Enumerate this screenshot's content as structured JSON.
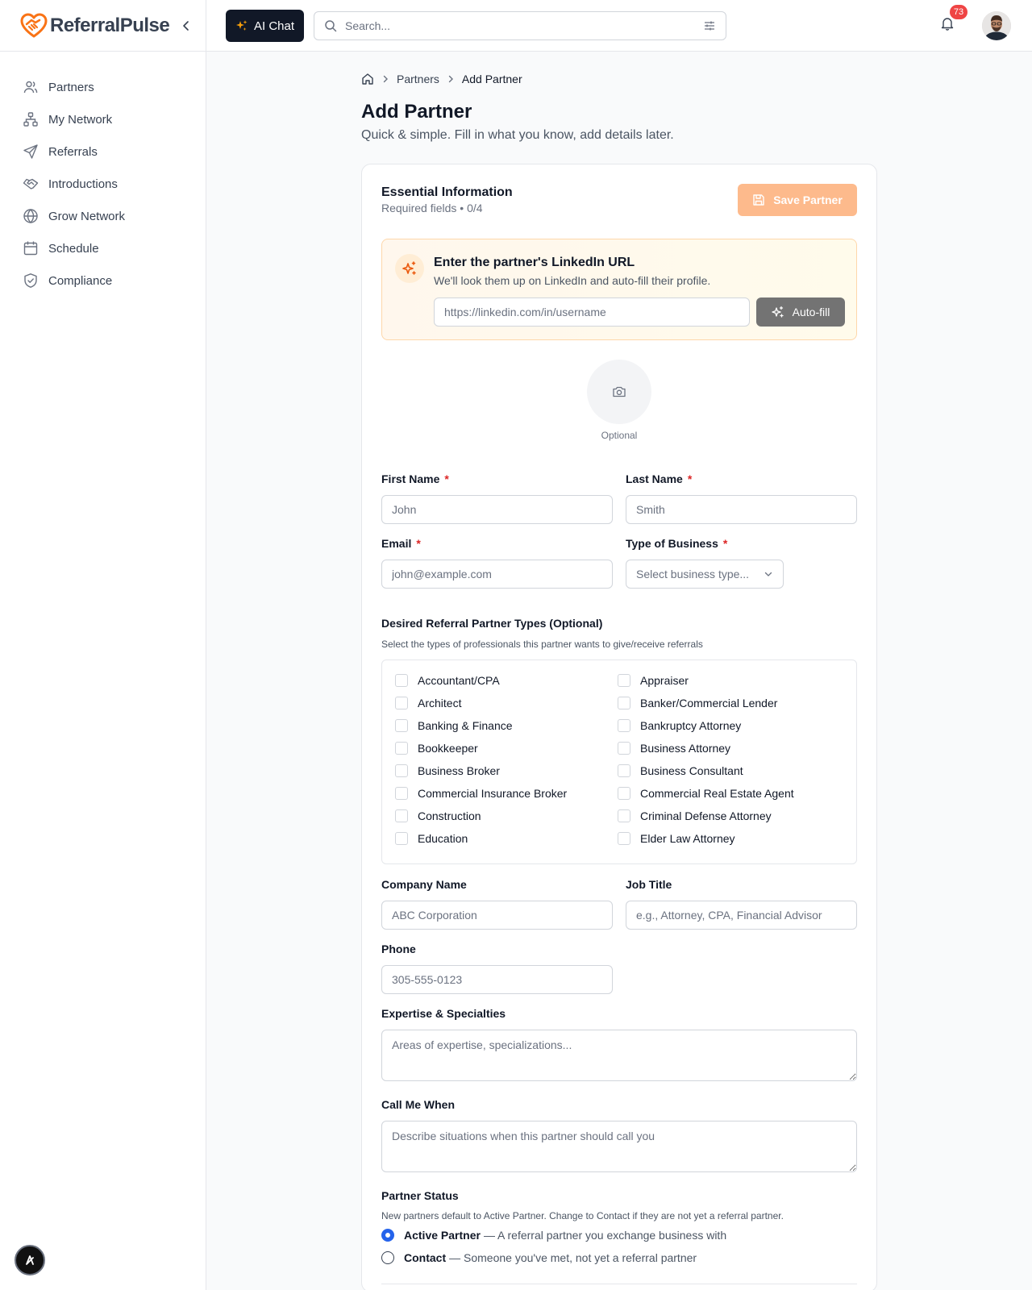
{
  "brand": {
    "name": "ReferralPulse",
    "logo": "heart-handshake-logo",
    "accent": "#f97316"
  },
  "sidebar": {
    "items": [
      {
        "label": "Partners",
        "icon": "users-icon"
      },
      {
        "label": "My Network",
        "icon": "network-icon"
      },
      {
        "label": "Referrals",
        "icon": "send-icon"
      },
      {
        "label": "Introductions",
        "icon": "handshake-icon"
      },
      {
        "label": "Grow Network",
        "icon": "globe-icon"
      },
      {
        "label": "Schedule",
        "icon": "calendar-icon"
      },
      {
        "label": "Compliance",
        "icon": "shield-check-icon"
      }
    ]
  },
  "topbar": {
    "ai_chat_label": "AI Chat",
    "search_placeholder": "Search...",
    "notification_count": "73"
  },
  "breadcrumb": {
    "level1": "Partners",
    "current": "Add Partner"
  },
  "page": {
    "title": "Add Partner",
    "subtitle": "Quick & simple. Fill in what you know, add details later."
  },
  "card": {
    "title": "Essential Information",
    "subtitle": "Required fields • 0/4",
    "save_label": "Save Partner"
  },
  "linkedin": {
    "title": "Enter the partner's LinkedIn URL",
    "description": "We'll look them up on LinkedIn and auto-fill their profile.",
    "placeholder": "https://linkedin.com/in/username",
    "button_label": "Auto-fill"
  },
  "photo": {
    "label": "Optional"
  },
  "fields": {
    "first_name": {
      "label": "First Name",
      "placeholder": "John",
      "required_mark": "*"
    },
    "last_name": {
      "label": "Last Name",
      "placeholder": "Smith",
      "required_mark": "*"
    },
    "email": {
      "label": "Email",
      "placeholder": "john@example.com",
      "required_mark": "*"
    },
    "business_type": {
      "label": "Type of Business",
      "placeholder": "Select business type...",
      "required_mark": "*"
    },
    "company": {
      "label": "Company Name",
      "placeholder": "ABC Corporation"
    },
    "job_title": {
      "label": "Job Title",
      "placeholder": "e.g., Attorney, CPA, Financial Advisor"
    },
    "phone": {
      "label": "Phone",
      "placeholder": "305-555-0123"
    },
    "expertise": {
      "label": "Expertise & Specialties",
      "placeholder": "Areas of expertise, specializations..."
    },
    "call_me_when": {
      "label": "Call Me When",
      "placeholder": "Describe situations when this partner should call you"
    }
  },
  "referral_types": {
    "label": "Desired Referral Partner Types (Optional)",
    "help": "Select the types of professionals this partner wants to give/receive referrals",
    "options": [
      "Accountant/CPA",
      "Appraiser",
      "Architect",
      "Banker/Commercial Lender",
      "Banking & Finance",
      "Bankruptcy Attorney",
      "Bookkeeper",
      "Business Attorney",
      "Business Broker",
      "Business Consultant",
      "Commercial Insurance Broker",
      "Commercial Real Estate Agent",
      "Construction",
      "Criminal Defense Attorney",
      "Education",
      "Elder Law Attorney"
    ]
  },
  "partner_status": {
    "label": "Partner Status",
    "help": "New partners default to Active Partner. Change to Contact if they are not yet a referral partner.",
    "options": [
      {
        "title": "Active Partner",
        "desc": "— A referral partner you exchange business with",
        "selected": true
      },
      {
        "title": "Contact",
        "desc": "— Someone you've met, not yet a referral partner",
        "selected": false
      }
    ]
  }
}
